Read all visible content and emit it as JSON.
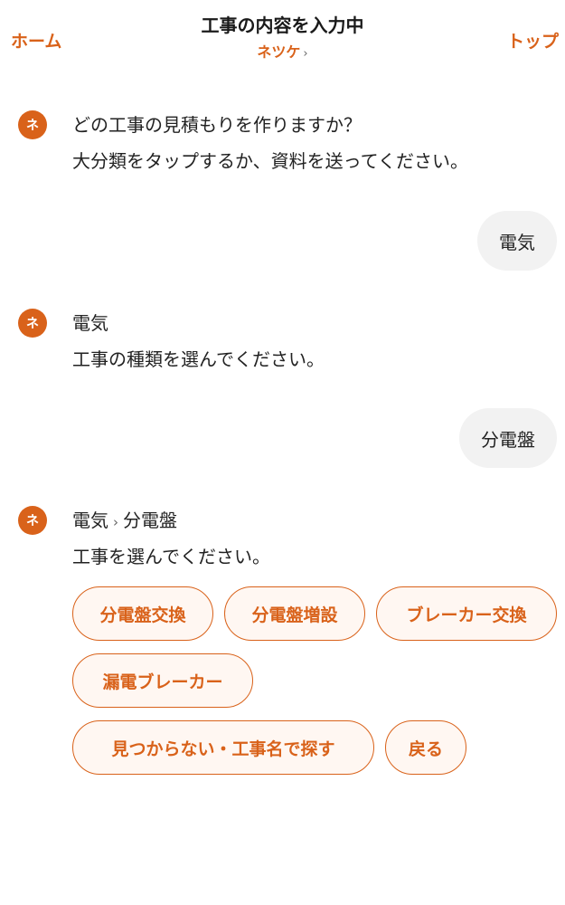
{
  "header": {
    "home_label": "ホーム",
    "title": "工事の内容を入力中",
    "subtitle": "ネツケ",
    "subtitle_chevron": "›",
    "top_label": "トップ"
  },
  "avatar_label": "ネ",
  "messages": [
    {
      "role": "bot",
      "lines": [
        "どの工事の見積もりを作りますか？",
        "大分類をタップするか、資料を送ってください。"
      ]
    },
    {
      "role": "user",
      "text": "電気"
    },
    {
      "role": "bot",
      "lines": [
        "電気",
        "工事の種類を選んでください。"
      ]
    },
    {
      "role": "user",
      "text": "分電盤"
    },
    {
      "role": "bot",
      "breadcrumb": [
        "電気",
        "分電盤"
      ],
      "breadcrumb_sep": "›",
      "lines": [
        "工事を選んでください。"
      ]
    }
  ],
  "options": [
    "分電盤交換",
    "分電盤増設",
    "ブレーカー交換",
    "漏電ブレーカー",
    "見つからない・工事名で探す",
    "戻る"
  ],
  "colors": {
    "accent": "#d9621a",
    "chip_bg": "#fff7f2",
    "user_bubble_bg": "#f2f2f2"
  }
}
